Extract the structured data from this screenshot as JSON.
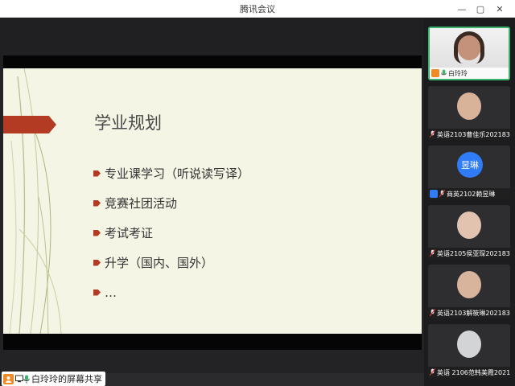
{
  "window": {
    "title": "腾讯会议",
    "min_icon": "—",
    "max_icon": "▢",
    "close_icon": "✕"
  },
  "slide": {
    "title": "学业规划",
    "bullets": [
      "专业课学习（听说读写译）",
      "竞赛社团活动",
      "考试考证",
      "升学（国内、国外）",
      "…"
    ]
  },
  "share_label": "白玲玲的屏幕共享",
  "participants": [
    {
      "name": "白玲玲",
      "type": "video",
      "active": true
    },
    {
      "name": "英语2103曹佳乐2021833…",
      "type": "video"
    },
    {
      "name": "商英2102赖昱琳",
      "type": "avatar",
      "avatar_text": "昱琳"
    },
    {
      "name": "英语2105侯亚琛2021833…",
      "type": "video"
    },
    {
      "name": "英语2103解筱琳2021833…",
      "type": "video"
    },
    {
      "name": "英语 2106范韩美霞2021…",
      "type": "video"
    }
  ],
  "colors": {
    "accent_red": "#b33b24",
    "slide_bg": "#f4f5e5",
    "avatar_blue": "#2f7cf6",
    "self_orange": "#f08a24",
    "active_green": "#3db46d"
  }
}
